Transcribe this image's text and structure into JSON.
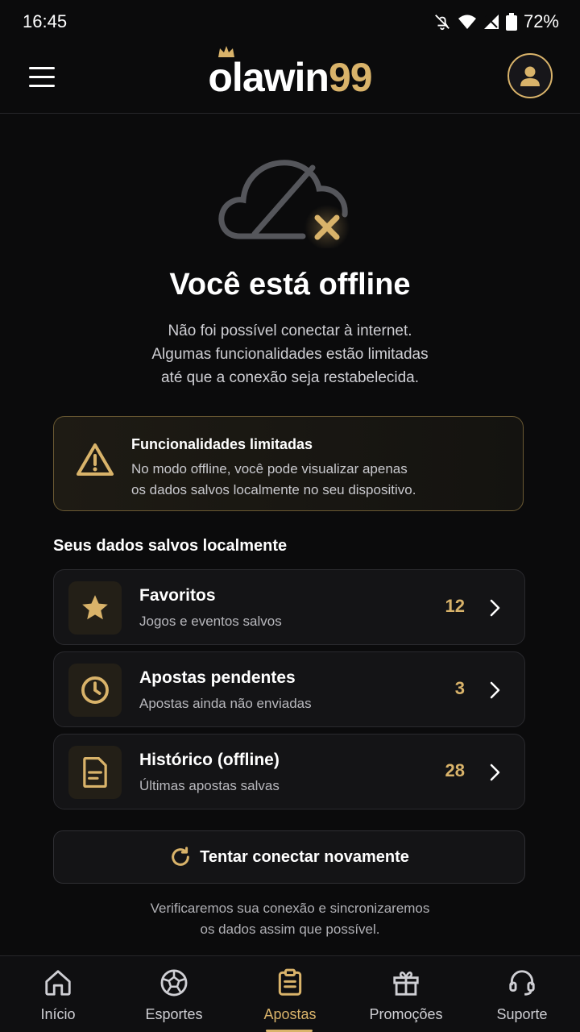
{
  "status": {
    "time": "16:45",
    "battery": "72%"
  },
  "header": {
    "logo_white": "olawin",
    "logo_gold": "99"
  },
  "hero": {
    "title": "Você está offline",
    "desc1": "Não foi possível conectar à internet.",
    "desc2": "Algumas funcionalidades estão limitadas",
    "desc3": "até que a conexão seja restabelecida."
  },
  "warning": {
    "title": "Funcionalidades limitadas",
    "text1": "No modo offline, você pode visualizar apenas",
    "text2": "os dados salvos localmente no seu dispositivo."
  },
  "local": {
    "section_title": "Seus dados salvos localmente",
    "items": [
      {
        "label": "Favoritos",
        "sub": "Jogos e eventos salvos",
        "count": "12",
        "icon": "star-icon"
      },
      {
        "label": "Apostas pendentes",
        "sub": "Apostas ainda não enviadas",
        "count": "3",
        "icon": "clock-icon"
      },
      {
        "label": "Histórico (offline)",
        "sub": "Últimas apostas salvas",
        "count": "28",
        "icon": "document-icon"
      }
    ]
  },
  "retry": {
    "label": "Tentar conectar novamente",
    "note1": "Verificaremos sua conexão e sincronizaremos",
    "note2": "os dados assim que possível."
  },
  "nav": [
    {
      "label": "Início",
      "icon": "home-icon"
    },
    {
      "label": "Esportes",
      "icon": "soccer-ball-icon"
    },
    {
      "label": "Apostas",
      "icon": "betslip-icon",
      "active": true
    },
    {
      "label": "Promoções",
      "icon": "gift-icon"
    },
    {
      "label": "Suporte",
      "icon": "headset-icon"
    }
  ],
  "colors": {
    "accent": "#d9b36a",
    "background": "#0b0b0c",
    "card": "#141416"
  }
}
